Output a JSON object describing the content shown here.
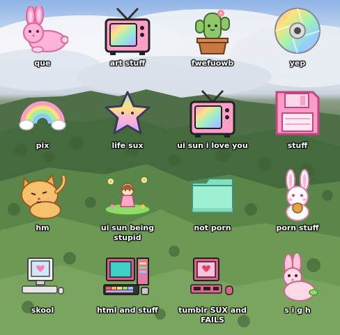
{
  "desktop": {
    "icons": [
      {
        "label": "que",
        "icon": "pink-bunny-icon"
      },
      {
        "label": "art stuff",
        "icon": "pink-tv-icon"
      },
      {
        "label": "fwefuowb",
        "icon": "cactus-icon"
      },
      {
        "label": "yep",
        "icon": "rainbow-cd-icon"
      },
      {
        "label": "pix",
        "icon": "rainbow-icon"
      },
      {
        "label": "life sux",
        "icon": "rainbow-star-icon"
      },
      {
        "label": "ui sun i love you",
        "icon": "pink-tv-icon"
      },
      {
        "label": "stuff",
        "icon": "floppy-disk-icon"
      },
      {
        "label": "hm",
        "icon": "orange-cat-icon"
      },
      {
        "label": "ui sun being stupid",
        "icon": "girl-garden-icon"
      },
      {
        "label": "not porn",
        "icon": "mint-folder-icon"
      },
      {
        "label": "porn stuff",
        "icon": "bunny-cookie-icon"
      },
      {
        "label": "skool",
        "icon": "computer-icon"
      },
      {
        "label": "html and stuff",
        "icon": "retro-computer-icon"
      },
      {
        "label": "tumblr SUX and FAILS",
        "icon": "pink-computer-icon"
      },
      {
        "label": "s i g h",
        "icon": "sitting-bunny-icon"
      }
    ]
  }
}
